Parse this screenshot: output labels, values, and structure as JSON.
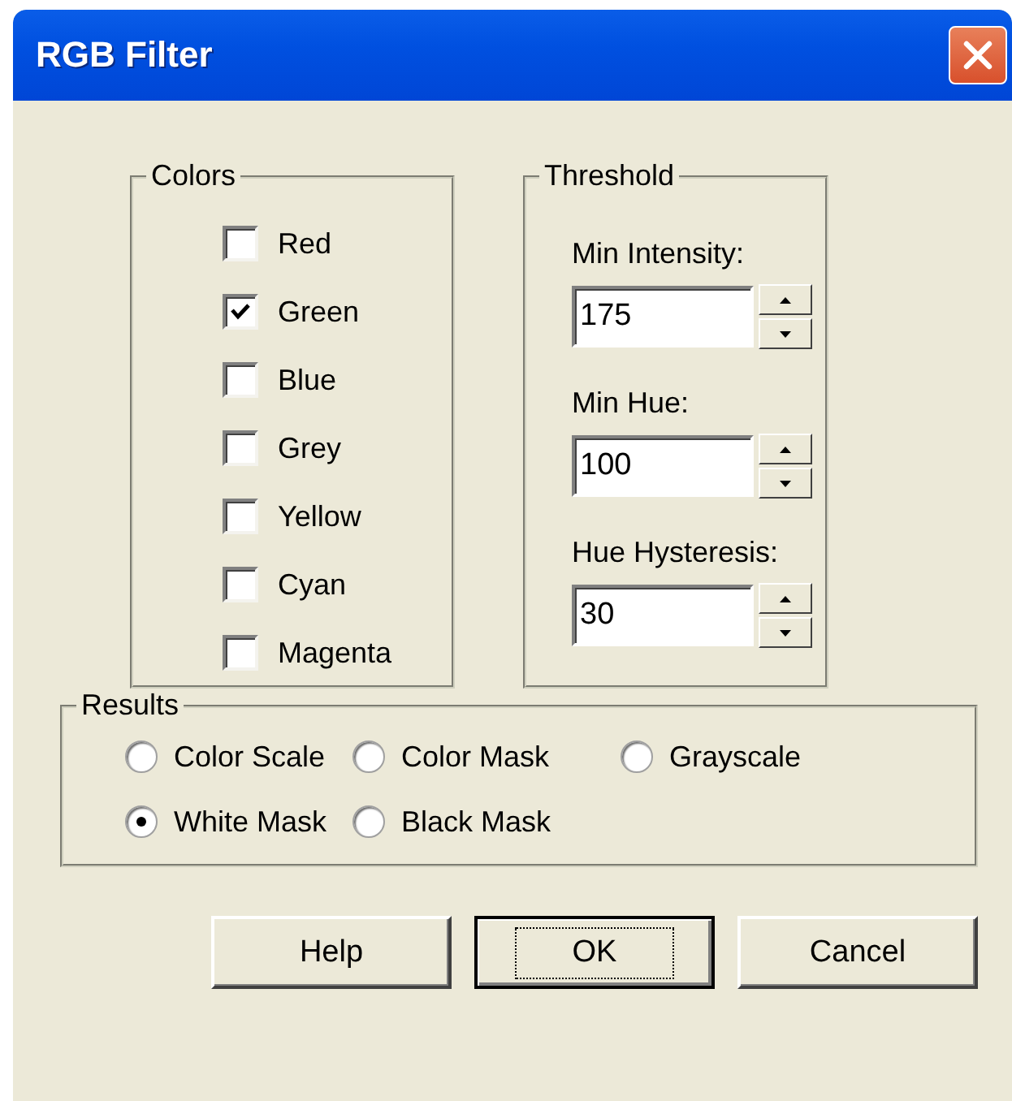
{
  "window": {
    "title": "RGB Filter"
  },
  "colors": {
    "label": "Colors",
    "items": [
      {
        "label": "Red",
        "checked": false
      },
      {
        "label": "Green",
        "checked": true
      },
      {
        "label": "Blue",
        "checked": false
      },
      {
        "label": "Grey",
        "checked": false
      },
      {
        "label": "Yellow",
        "checked": false
      },
      {
        "label": "Cyan",
        "checked": false
      },
      {
        "label": "Magenta",
        "checked": false
      }
    ]
  },
  "threshold": {
    "label": "Threshold",
    "fields": [
      {
        "label": "Min Intensity:",
        "value": "175"
      },
      {
        "label": "Min Hue:",
        "value": "100"
      },
      {
        "label": "Hue Hysteresis:",
        "value": "30"
      }
    ]
  },
  "results": {
    "label": "Results",
    "options": [
      {
        "label": "Color Scale",
        "selected": false
      },
      {
        "label": "Color Mask",
        "selected": false
      },
      {
        "label": "Grayscale",
        "selected": false
      },
      {
        "label": "White Mask",
        "selected": true
      },
      {
        "label": "Black Mask",
        "selected": false
      }
    ]
  },
  "buttons": [
    {
      "label": "Help",
      "default": false
    },
    {
      "label": "OK",
      "default": true
    },
    {
      "label": "Cancel",
      "default": false
    }
  ]
}
